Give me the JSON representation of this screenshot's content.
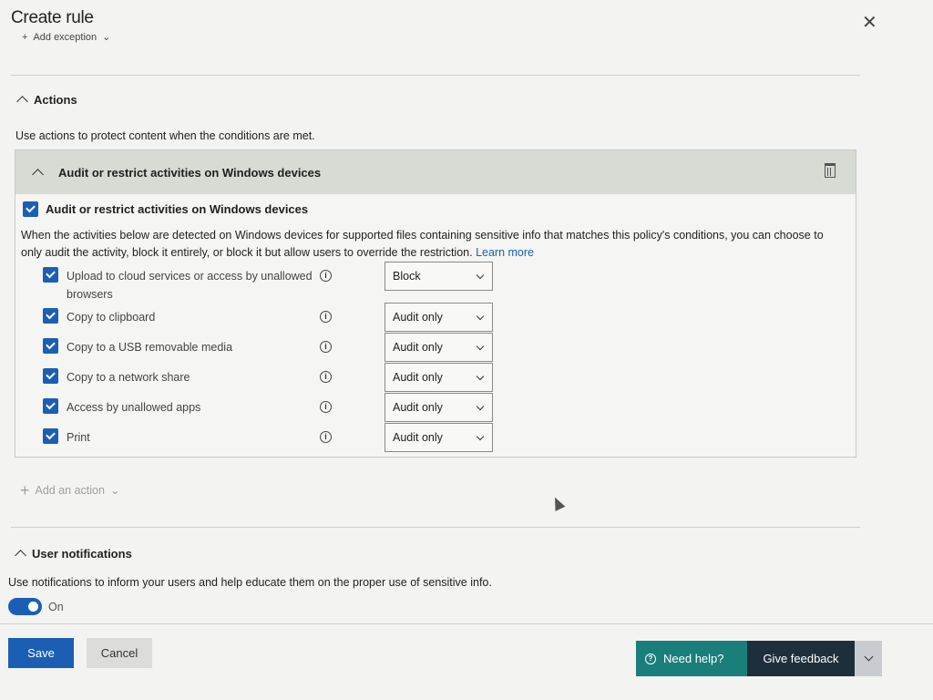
{
  "header": {
    "title": "Create rule",
    "close_icon": "close-icon",
    "add_exception": "Add exception"
  },
  "actions_section": {
    "title": "Actions",
    "description": "Use actions to protect content when the conditions are met."
  },
  "action_card": {
    "title": "Audit or restrict activities on Windows devices",
    "checkbox_label": "Audit or restrict activities on Windows devices",
    "description": "When the activities below are detected on Windows devices for supported files containing sensitive info that matches this policy's conditions, you can choose to only audit the activity, block it entirely, or block it but allow users to override the restriction.",
    "learn_more": "Learn more",
    "activities": [
      {
        "label": "Upload to cloud services or access by unallowed browsers",
        "value": "Block",
        "checked": true
      },
      {
        "label": "Copy to clipboard",
        "value": "Audit only",
        "checked": true
      },
      {
        "label": "Copy to a USB removable media",
        "value": "Audit only",
        "checked": true
      },
      {
        "label": "Copy to a network share",
        "value": "Audit only",
        "checked": true
      },
      {
        "label": "Access by unallowed apps",
        "value": "Audit only",
        "checked": true
      },
      {
        "label": "Print",
        "value": "Audit only",
        "checked": true
      }
    ]
  },
  "add_action": "Add an action",
  "notifications_section": {
    "title": "User notifications",
    "description": "Use notifications to inform your users and help educate them on the proper use of sensitive info.",
    "toggle_label": "On",
    "toggle_on": true
  },
  "footer": {
    "save": "Save",
    "cancel": "Cancel",
    "need_help": "Need help?",
    "give_feedback": "Give feedback"
  },
  "colors": {
    "primary": "#1b5fb4",
    "help_teal": "#1a7f7b",
    "feedback_navy": "#1e2f3c"
  }
}
